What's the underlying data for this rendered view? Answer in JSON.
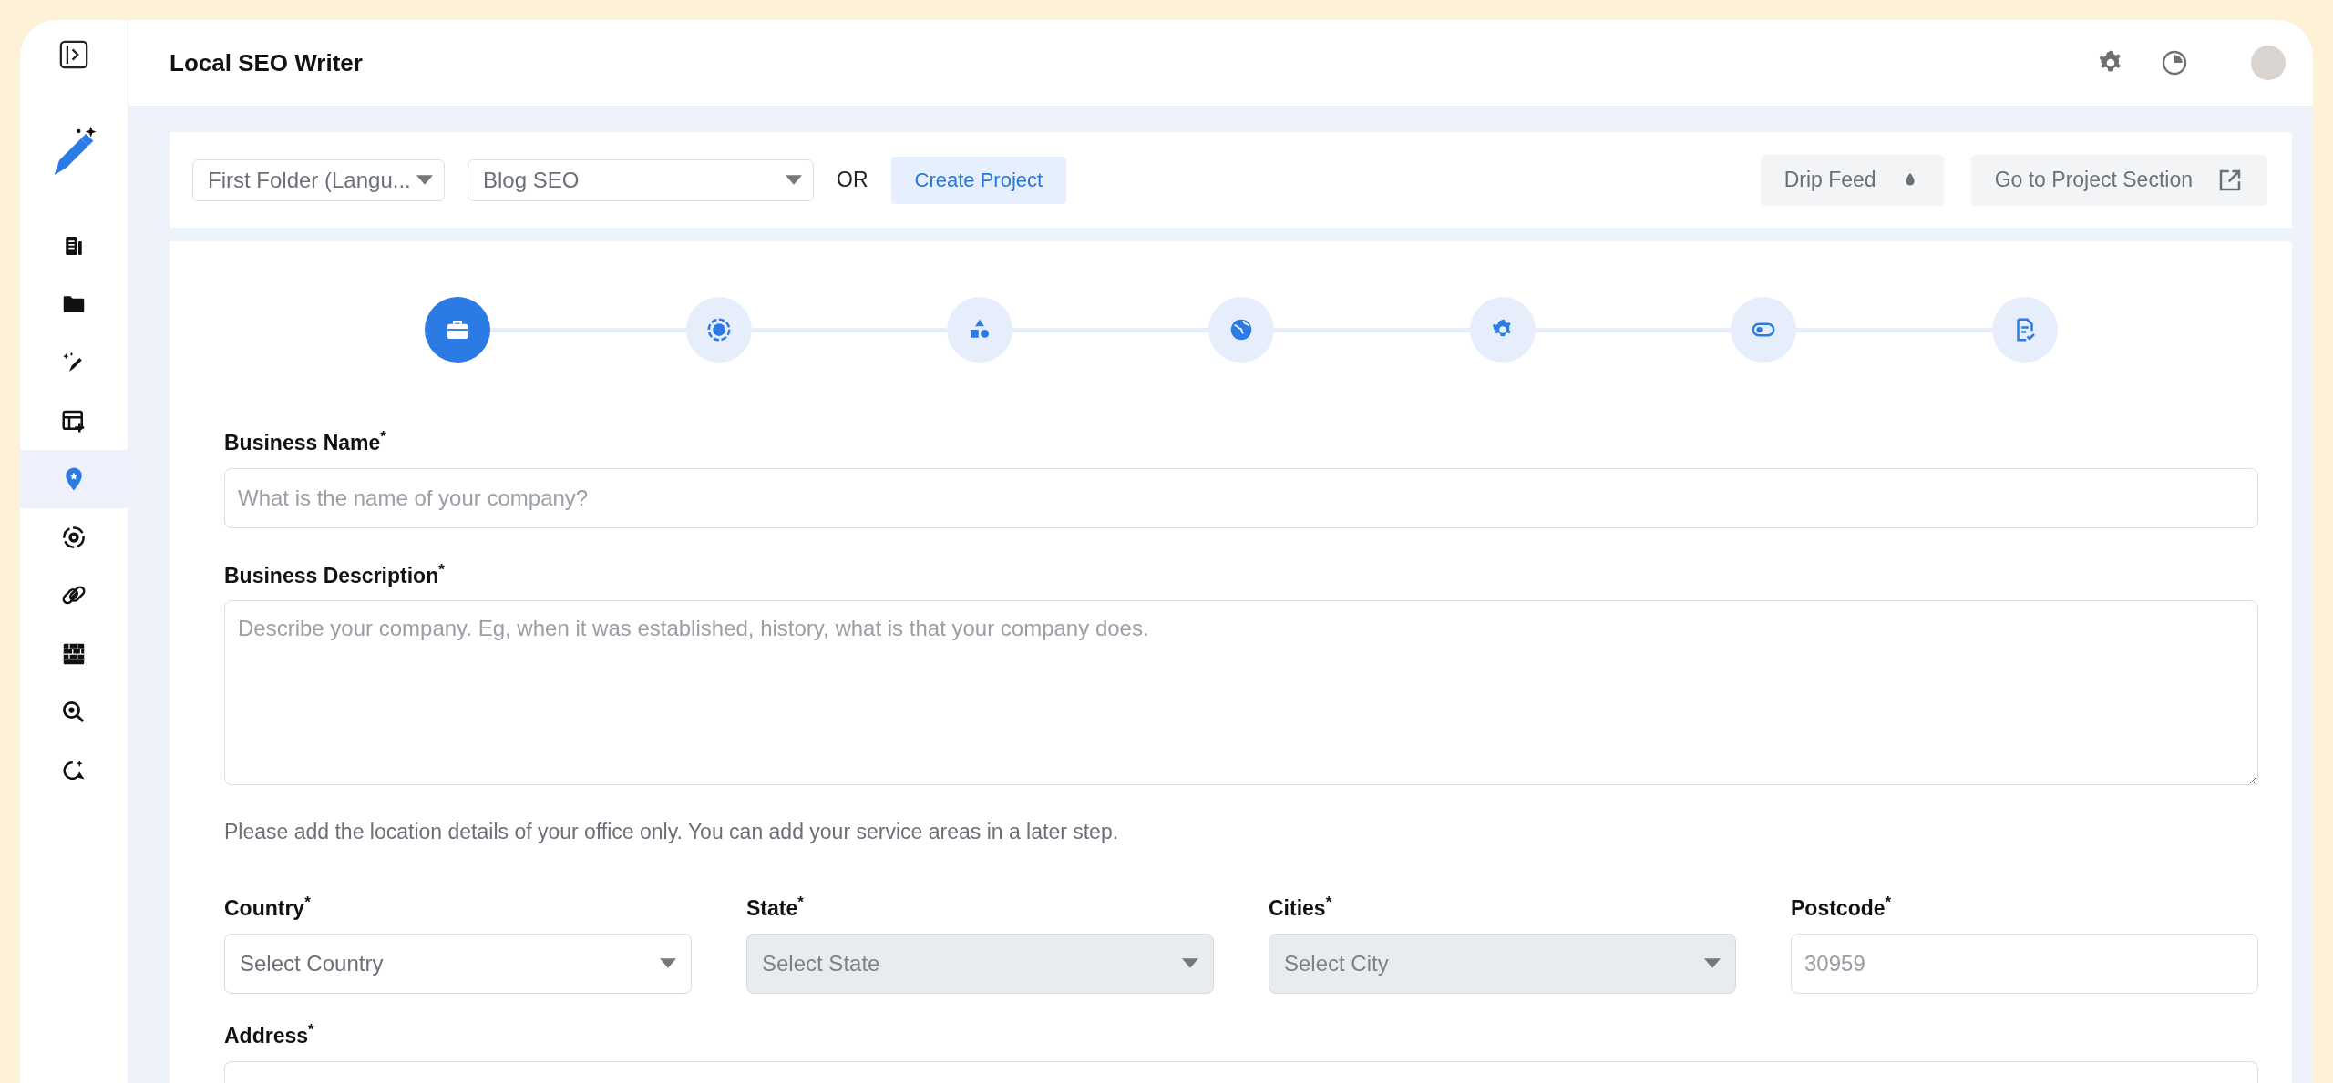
{
  "header": {
    "title": "Local SEO Writer"
  },
  "sidebar": {
    "items": [
      {
        "selected": false
      },
      {
        "selected": false
      },
      {
        "selected": false
      },
      {
        "selected": false
      },
      {
        "selected": true
      },
      {
        "selected": false
      },
      {
        "selected": false
      },
      {
        "selected": false
      },
      {
        "selected": false
      },
      {
        "selected": false
      }
    ]
  },
  "toolbar": {
    "folder_select": {
      "value": "First Folder (Langu..."
    },
    "project_select": {
      "value": "Blog SEO"
    },
    "or_label": "OR",
    "create_button": "Create Project",
    "drip_feed_button": "Drip Feed",
    "project_section_button": "Go to Project Section"
  },
  "steps": [
    {
      "selected": true
    },
    {
      "selected": false
    },
    {
      "selected": false
    },
    {
      "selected": false
    },
    {
      "selected": false
    },
    {
      "selected": false
    },
    {
      "selected": false
    }
  ],
  "form": {
    "business_name": {
      "label": "Business Name$^{*}$",
      "placeholder": "What is the name of your company?"
    },
    "business_description": {
      "label": "Business Description$^{*}$",
      "placeholder": "Describe your company. Eg, when it was established, history, what is that your company does."
    },
    "note": "Please add the location details of your office only. You can add your service areas in a later step.",
    "location_fields": [
      {
        "label": "Country$^{*}$",
        "kind": "select",
        "placeholder": "Select Country",
        "disabled": false
      },
      {
        "label": "State$^{*}$",
        "kind": "select",
        "placeholder": "Select State",
        "disabled": true
      },
      {
        "label": "Cities$^{*}$",
        "kind": "select",
        "placeholder": "Select City",
        "disabled": true
      },
      {
        "label": "Postcode$^{*}$",
        "kind": "text",
        "placeholder": "30959",
        "disabled": false
      }
    ],
    "address": {
      "label": "Address$^{*}$"
    }
  }
}
